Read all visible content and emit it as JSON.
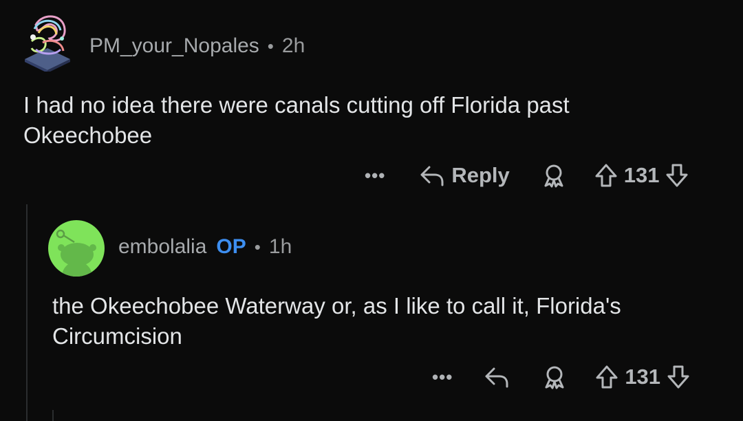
{
  "comments": [
    {
      "username": "PM_your_Nopales",
      "separator": "•",
      "age": "2h",
      "text_line1": "I had no idea there were canals cutting off Florida past",
      "text_line2": "Okeechobee",
      "more_label": "•••",
      "reply_label": "Reply",
      "award_icon": "award-icon",
      "votes": "131"
    },
    {
      "username": "embolalia",
      "op_badge": "OP",
      "separator": "•",
      "age": "1h",
      "text_line1": "the Okeechobee Waterway or, as I like to call it, Florida's",
      "text_line2": "Circumcision",
      "more_label": "•••",
      "award_icon": "award-icon",
      "votes": "131"
    }
  ],
  "colors": {
    "background": "#0b0b0b",
    "op_badge": "#3d8ef0",
    "avatar_green": "#7fe35a"
  }
}
